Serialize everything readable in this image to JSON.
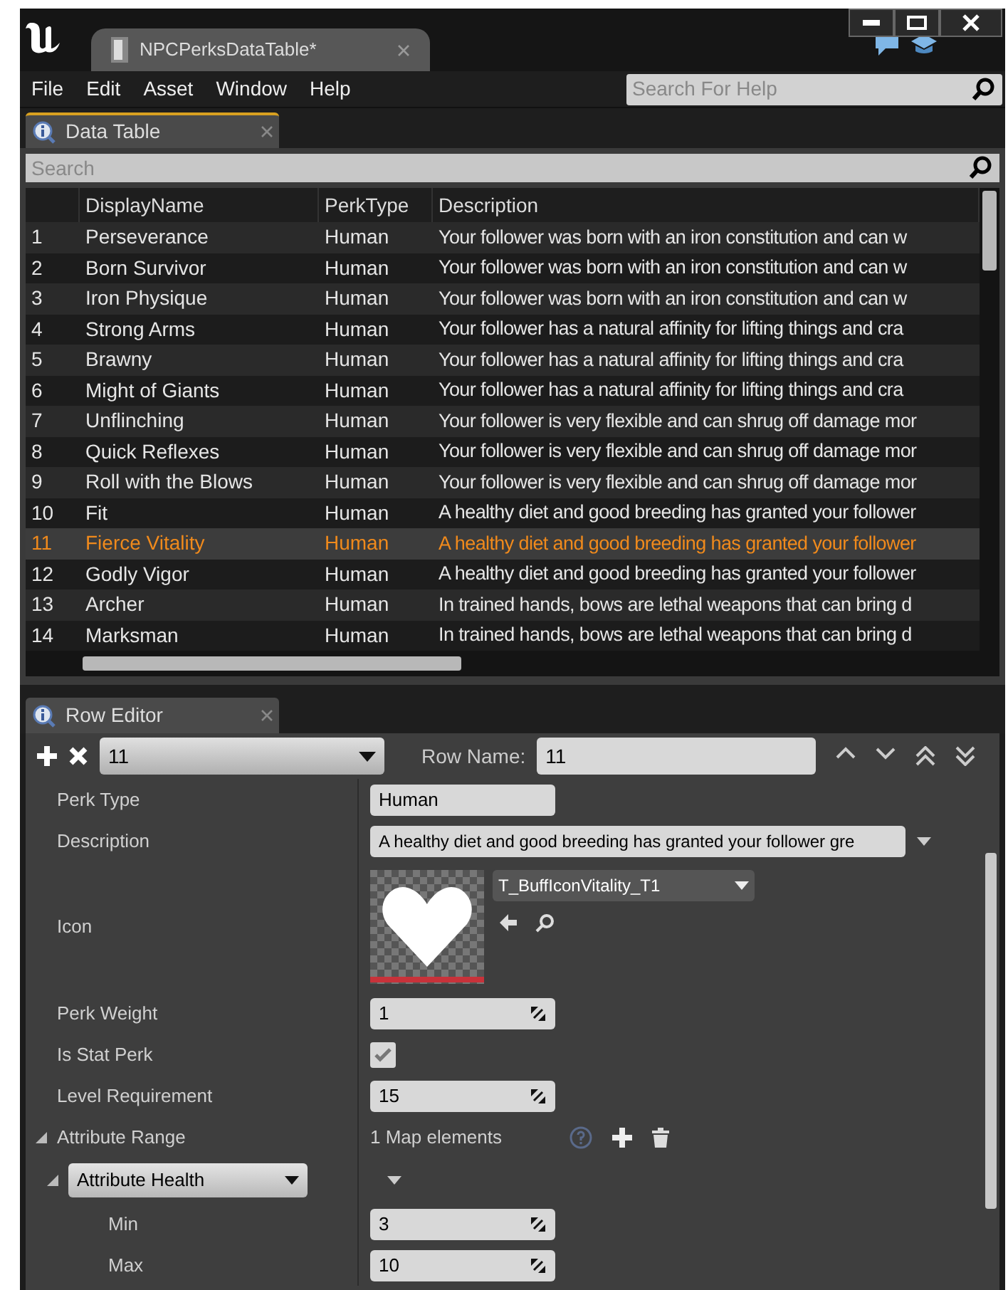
{
  "window": {
    "tab_title": "NPCPerksDataTable*"
  },
  "menu": [
    "File",
    "Edit",
    "Asset",
    "Window",
    "Help"
  ],
  "help_search": {
    "placeholder": "Search For Help"
  },
  "data_table": {
    "tab": "Data Table",
    "search": {
      "placeholder": "Search"
    },
    "columns": [
      "DisplayName",
      "PerkType",
      "Description"
    ],
    "rows": [
      {
        "index": "1",
        "name": "Perseverance",
        "type": "Human",
        "description": "Your follower was born with an iron constitution and can w",
        "selected": false
      },
      {
        "index": "2",
        "name": "Born Survivor",
        "type": "Human",
        "description": "Your follower was born with an iron constitution and can w",
        "selected": false
      },
      {
        "index": "3",
        "name": "Iron Physique",
        "type": "Human",
        "description": "Your follower was born with an iron constitution and can w",
        "selected": false
      },
      {
        "index": "4",
        "name": "Strong Arms",
        "type": "Human",
        "description": "Your follower has a natural affinity for lifting things and cra",
        "selected": false
      },
      {
        "index": "5",
        "name": "Brawny",
        "type": "Human",
        "description": "Your follower has a natural affinity for lifting things and cra",
        "selected": false
      },
      {
        "index": "6",
        "name": "Might of Giants",
        "type": "Human",
        "description": "Your follower has a natural affinity for lifting things and cra",
        "selected": false
      },
      {
        "index": "7",
        "name": "Unflinching",
        "type": "Human",
        "description": "Your follower is very flexible and can shrug off damage mor",
        "selected": false
      },
      {
        "index": "8",
        "name": "Quick Reflexes",
        "type": "Human",
        "description": "Your follower is very flexible and can shrug off damage mor",
        "selected": false
      },
      {
        "index": "9",
        "name": "Roll with the Blows",
        "type": "Human",
        "description": "Your follower is very flexible and can shrug off damage mor",
        "selected": false
      },
      {
        "index": "10",
        "name": "Fit",
        "type": "Human",
        "description": "A healthy diet and good breeding has granted your follower",
        "selected": false
      },
      {
        "index": "11",
        "name": "Fierce Vitality",
        "type": "Human",
        "description": "A healthy diet and good breeding has granted your follower",
        "selected": true
      },
      {
        "index": "12",
        "name": "Godly Vigor",
        "type": "Human",
        "description": "A healthy diet and good breeding has granted your follower",
        "selected": false
      },
      {
        "index": "13",
        "name": "Archer",
        "type": "Human",
        "description": "In trained hands, bows are lethal weapons that can bring d",
        "selected": false
      },
      {
        "index": "14",
        "name": "Marksman",
        "type": "Human",
        "description": "In trained hands, bows are lethal weapons that can bring d",
        "selected": false
      }
    ]
  },
  "row_editor": {
    "tab": "Row Editor",
    "row_select": "11",
    "row_name_label": "Row Name:",
    "row_name": "11",
    "properties": [
      {
        "kind": "text",
        "label": "Perk Type",
        "value": "Human"
      },
      {
        "kind": "dropdown_text",
        "label": "Description",
        "value": "A healthy diet and good breeding has granted your follower gre"
      },
      {
        "kind": "asset",
        "label": "Icon",
        "value": "T_BuffIconVitality_T1"
      },
      {
        "kind": "number",
        "label": "Perk Weight",
        "value": "1"
      },
      {
        "kind": "checkbox",
        "label": "Is Stat Perk",
        "checked": true
      },
      {
        "kind": "number",
        "label": "Level Requirement",
        "value": "15"
      },
      {
        "kind": "map",
        "label": "Attribute Range",
        "value": "1 Map elements",
        "expanded": true,
        "children": [
          {
            "kind": "key",
            "label": "Attribute Health",
            "expanded": true,
            "children": [
              {
                "kind": "number",
                "label": "Min",
                "value": "3"
              },
              {
                "kind": "number",
                "label": "Max",
                "value": "10"
              }
            ]
          }
        ]
      }
    ]
  }
}
